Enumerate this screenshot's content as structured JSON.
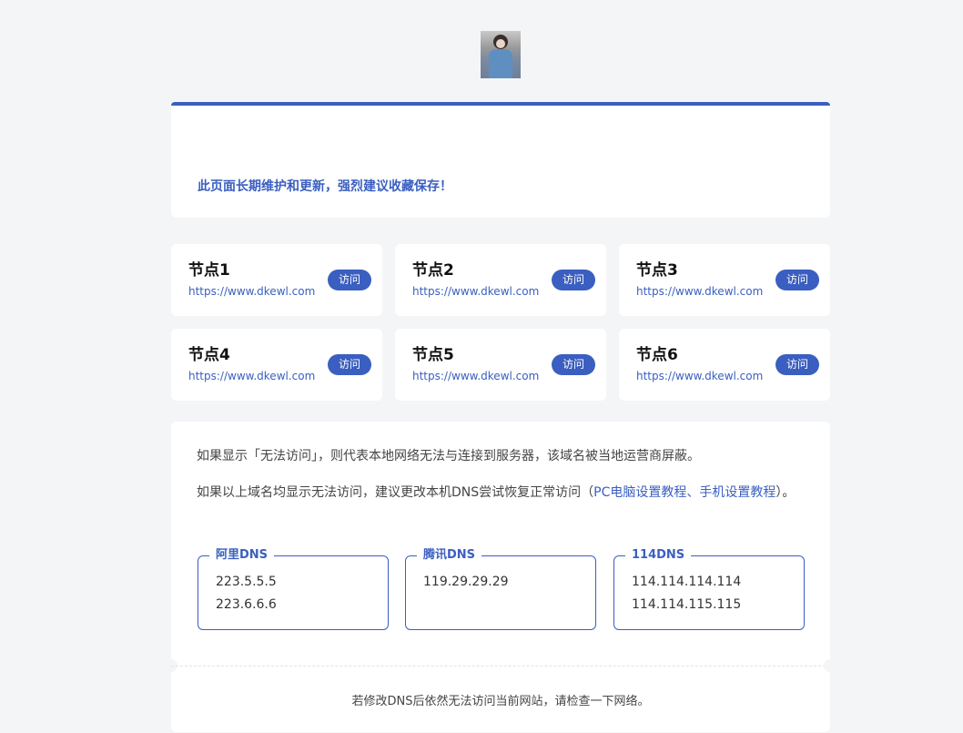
{
  "avatar": {
    "alt": "avatar"
  },
  "notice": {
    "text": "此页面长期维护和更新，强烈建议收藏保存！",
    "accent": "#3a5fc0"
  },
  "nodes": [
    {
      "title": "节点1",
      "url": "https://www.dkewl.com",
      "button": "访问"
    },
    {
      "title": "节点2",
      "url": "https://www.dkewl.com",
      "button": "访问"
    },
    {
      "title": "节点3",
      "url": "https://www.dkewl.com",
      "button": "访问"
    },
    {
      "title": "节点4",
      "url": "https://www.dkewl.com",
      "button": "访问"
    },
    {
      "title": "节点5",
      "url": "https://www.dkewl.com",
      "button": "访问"
    },
    {
      "title": "节点6",
      "url": "https://www.dkewl.com",
      "button": "访问"
    }
  ],
  "info": {
    "line1": "如果显示「无法访问」，则代表本地网络无法与连接到服务器，该域名被当地运营商屏蔽。",
    "line2_prefix": "如果以上域名均显示无法访问，建议更改本机DNS尝试恢复正常访问（",
    "pc_link": "PC电脑设置教程",
    "separator": "、",
    "mobile_link": "手机设置教程",
    "line2_suffix": "）。"
  },
  "dns": [
    {
      "label": "阿里DNS",
      "ips": [
        "223.5.5.5",
        "223.6.6.6"
      ]
    },
    {
      "label": "腾讯DNS",
      "ips": [
        "119.29.29.29"
      ]
    },
    {
      "label": "114DNS",
      "ips": [
        "114.114.114.114",
        "114.114.115.115"
      ]
    }
  ],
  "footer": {
    "text": "若修改DNS后依然无法访问当前网站，请检查一下网络。"
  }
}
